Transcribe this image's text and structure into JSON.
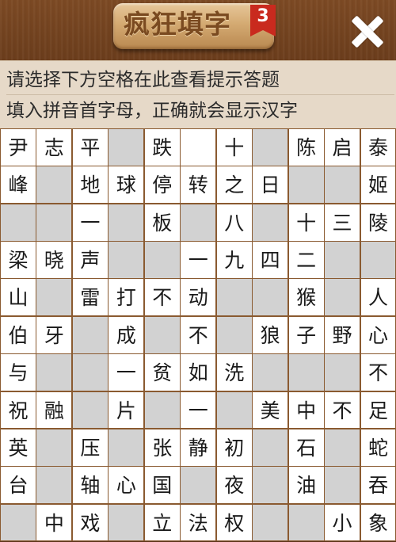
{
  "header": {
    "title": "疯狂填字",
    "level": "3",
    "close_icon": "close-icon"
  },
  "hints": {
    "line1": "请选择下方空格在此查看提示答题",
    "line2": "填入拼音首字母，正确就会显示汉字"
  },
  "colors": {
    "wood": "#6e3f1d",
    "hint_bg": "#e6d9c8",
    "cell_white": "#ffffff",
    "cell_gray": "#d2d2d2",
    "badge_red": "#c92a1e"
  },
  "grid": {
    "rows": [
      [
        "尹",
        "志",
        "平",
        "#",
        "跌",
        "",
        "十",
        "#",
        "陈",
        "启",
        "泰"
      ],
      [
        "峰",
        "#",
        "地",
        "球",
        "停",
        "转",
        "之",
        "日",
        "#",
        "#",
        "姬"
      ],
      [
        "#",
        "#",
        "一",
        "#",
        "板",
        "#",
        "八",
        "#",
        "十",
        "三",
        "陵"
      ],
      [
        "梁",
        "晓",
        "声",
        "#",
        "#",
        "一",
        "九",
        "四",
        "二",
        "#",
        "#"
      ],
      [
        "山",
        "#",
        "雷",
        "打",
        "不",
        "动",
        "#",
        "#",
        "猴",
        "#",
        "人"
      ],
      [
        "伯",
        "牙",
        "#",
        "成",
        "#",
        "不",
        "#",
        "狼",
        "子",
        "野",
        "心"
      ],
      [
        "与",
        "#",
        "#",
        "一",
        "贫",
        "如",
        "洗",
        "#",
        "#",
        "#",
        "不"
      ],
      [
        "祝",
        "融",
        "#",
        "片",
        "#",
        "一",
        "#",
        "美",
        "中",
        "不",
        "足"
      ],
      [
        "英",
        "#",
        "压",
        "#",
        "张",
        "静",
        "初",
        "#",
        "石",
        "#",
        "蛇"
      ],
      [
        "台",
        "#",
        "轴",
        "心",
        "国",
        "#",
        "夜",
        "#",
        "油",
        "#",
        "吞"
      ],
      [
        "#",
        "中",
        "戏",
        "#",
        "立",
        "法",
        "权",
        "#",
        "#",
        "小",
        "象"
      ]
    ]
  }
}
